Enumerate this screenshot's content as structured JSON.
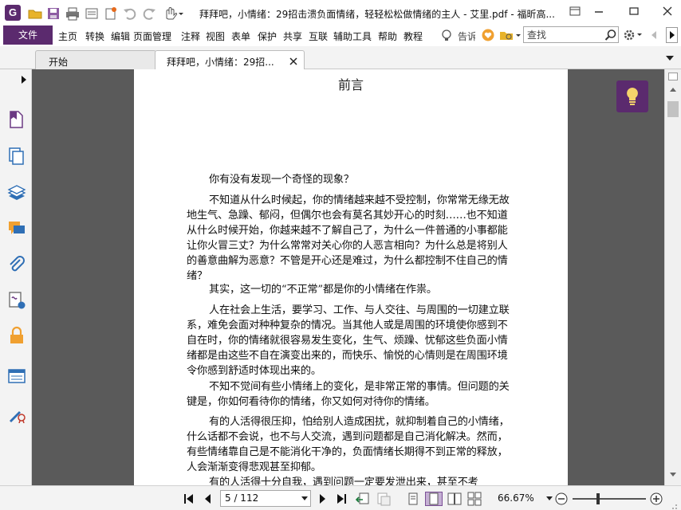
{
  "app": {
    "logo_letter": "G",
    "window_title": "拜拜吧，小情绪：29招击溃负面情绪，轻轻松松做情绪的主人 - 艾里.pdf - 福昕高..."
  },
  "menu": {
    "file_label": "文件",
    "items": [
      "主页",
      "转换",
      "编辑",
      "页面管理",
      "注释",
      "视图",
      "表单",
      "保护",
      "共享",
      "互联",
      "辅助工具",
      "帮助",
      "教程"
    ],
    "tell_me_label": "告诉",
    "search_placeholder": "查找"
  },
  "tabs": [
    {
      "label": "开始"
    },
    {
      "label": "拜拜吧，小情绪：29招..."
    }
  ],
  "document": {
    "heading": "前言",
    "paragraphs": [
      "你有没有发现一个奇怪的现象？",
      "不知道从什么时候起，你的情绪越来越不受控制，你常常无缘无故地生气、急躁、郁闷，但偶尔也会有莫名其妙开心的时刻……也不知道从什么时候开始，你越来越不了解自己了，为什么一件普通的小事都能让你火冒三丈？为什么常常对关心你的人恶言相向？为什么总是将别人的善意曲解为恶意？不管是开心还是难过，为什么都控制不住自己的情绪？",
      "其实，这一切的“不正常”都是你的小情绪在作祟。",
      "人在社会上生活，要学习、工作、与人交往、与周围的一切建立联系，难免会面对种种复杂的情况。当其他人或是周围的环境使你感到不自在时，你的情绪就很容易发生变化，生气、烦躁、忧郁这些负面小情绪都是由这些不自在演变出来的，而快乐、愉悦的心情则是在周围环境令你感到舒适时体现出来的。",
      "不知不觉间有些小情绪上的变化，是非常正常的事情。但问题的关键是，你如何看待你的情绪，你又如何对待你的情绪。",
      "有的人活得很压抑，怕给别人造成困扰，就抑制着自己的小情绪，什么话都不会说，也不与人交流，遇到问题都是自己消化解决。然而，有些情绪靠自己是不能消化干净的，负面情绪长期得不到正常的释放，人会渐渐变得悲观甚至抑郁。",
      "有的人活得十分自我，遇到问题一定要发泄出来，甚至不考"
    ]
  },
  "statusbar": {
    "page_indicator": "5 / 112",
    "zoom": "66.67%"
  },
  "colors": {
    "brand": "#5b2a6e",
    "doc_background": "#5a5a5a"
  }
}
